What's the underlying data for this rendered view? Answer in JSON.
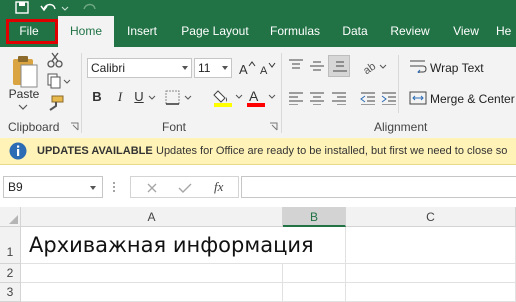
{
  "ribbon_tabs": [
    "File",
    "Home",
    "Insert",
    "Page Layout",
    "Formulas",
    "Data",
    "Review",
    "View",
    "He"
  ],
  "active_tab": "Home",
  "clipboard": {
    "paste_label": "Paste",
    "group_label": "Clipboard"
  },
  "font": {
    "name": "Calibri",
    "size": "11",
    "bold": "B",
    "italic": "I",
    "underline": "U",
    "group_label": "Font"
  },
  "alignment": {
    "wrap_text": "Wrap Text",
    "merge_center": "Merge & Center",
    "group_label": "Alignment"
  },
  "infobar": {
    "title": "UPDATES AVAILABLE",
    "message": "Updates for Office are ready to be installed, but first we need to close so"
  },
  "formula_bar": {
    "name_box": "B9",
    "fx": "fx",
    "formula": ""
  },
  "sheet": {
    "columns": [
      "A",
      "B",
      "C"
    ],
    "selected_column": "B",
    "rows": [
      "1",
      "2",
      "3"
    ],
    "cells": {
      "A1": "Архиважная информация"
    }
  },
  "colors": {
    "excel_green": "#217346",
    "highlight_yellow": "#ffff00",
    "font_red": "#ff0000",
    "info_blue": "#2b6cb5"
  }
}
